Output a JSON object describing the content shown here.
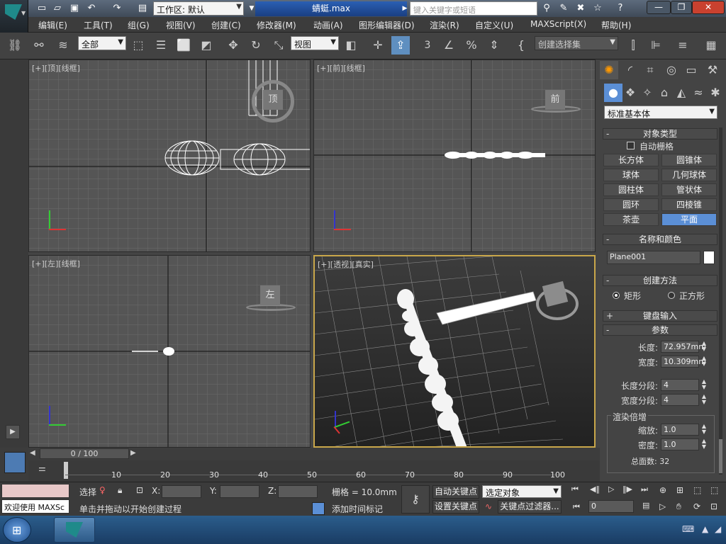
{
  "titlebar": {
    "workspace_label": "工作区: 默认",
    "file_title": "蜻蜓.max",
    "search_placeholder": "键入关键字或短语"
  },
  "menu": [
    "编辑(E)",
    "工具(T)",
    "组(G)",
    "视图(V)",
    "创建(C)",
    "修改器(M)",
    "动画(A)",
    "图形编辑器(D)",
    "渲染(R)",
    "自定义(U)",
    "MAXScript(X)",
    "帮助(H)"
  ],
  "toolbar": {
    "selection_filter": "全部",
    "ref_coord": "视图",
    "named_selection_placeholder": "创建选择集",
    "snap_label": "3"
  },
  "viewports": [
    {
      "label": "[+][顶][线框]"
    },
    {
      "label": "[+][前][线框]"
    },
    {
      "label": "[+][左][线框]"
    },
    {
      "label": "[+][透视][真实]"
    }
  ],
  "viewcube": {
    "top": "顶",
    "front": "前",
    "left": "左"
  },
  "command_panel": {
    "category": "标准基本体",
    "object_type": {
      "title": "对象类型",
      "autogrid": "自动栅格",
      "buttons": [
        "长方体",
        "圆锥体",
        "球体",
        "几何球体",
        "圆柱体",
        "管状体",
        "圆环",
        "四棱锥",
        "茶壶",
        "平面"
      ],
      "selected": "平面"
    },
    "name_color": {
      "title": "名称和颜色",
      "name": "Plane001",
      "swatch_color": "#ffffff"
    },
    "creation_method": {
      "title": "创建方法",
      "options": [
        "矩形",
        "正方形"
      ],
      "selected": "矩形"
    },
    "keyboard_entry": {
      "title": "键盘输入"
    },
    "params": {
      "title": "参数",
      "length_label": "长度:",
      "length": "72.957mm",
      "width_label": "宽度:",
      "width": "10.309mm",
      "length_segs_label": "长度分段:",
      "length_segs": "4",
      "width_segs_label": "宽度分段:",
      "width_segs": "4",
      "render_mult": "渲染倍增",
      "scale_label": "缩放:",
      "scale": "1.0",
      "density_label": "密度:",
      "density": "1.0",
      "total_faces": "总面数: 32"
    }
  },
  "timeline": {
    "frame_label": "0 / 100",
    "ticks": [
      "10",
      "20",
      "30",
      "40",
      "50",
      "60",
      "70",
      "80",
      "90",
      "100"
    ]
  },
  "status": {
    "welcome": "欢迎使用 MAXSc",
    "select_label": "选择",
    "x_label": "X:",
    "y_label": "Y:",
    "z_label": "Z:",
    "grid": "栅格 = 10.0mm",
    "prompt": "单击并拖动以开始创建过程",
    "add_time_tag": "添加时间标记",
    "auto_key": "自动关键点",
    "set_key": "设置关键点",
    "key_mode": "选定对象",
    "key_filters": "关键点过滤器...",
    "frame_field": "0"
  },
  "colors": {
    "accent": "#5b8fd6",
    "viewport_bg": "#555555",
    "active_viewport_border": "#c9a74a"
  }
}
